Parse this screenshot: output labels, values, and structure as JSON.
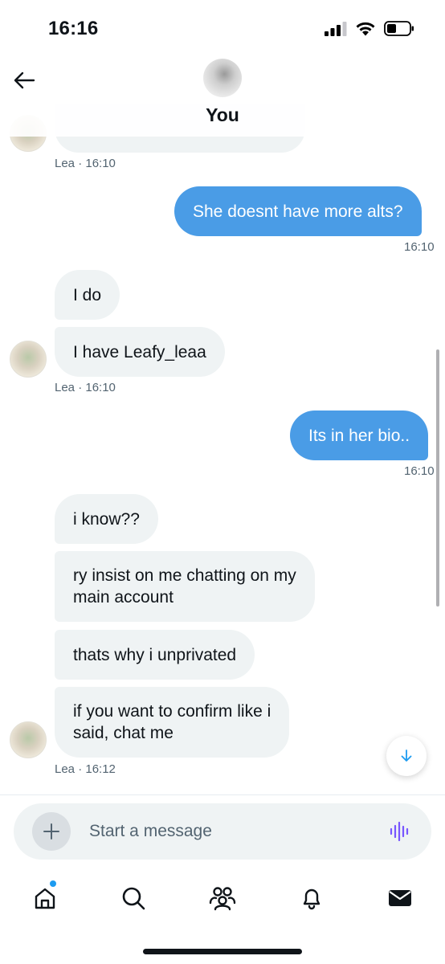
{
  "status_bar": {
    "time": "16:16"
  },
  "header": {
    "title": "You"
  },
  "messages": {
    "m1_meta": "Lea · 16:10",
    "m2_text": "She doesnt have more alts?",
    "m2_time": "16:10",
    "m3_text": "I do",
    "m4_text": "I have Leafy_leaa",
    "m4_meta": "Lea · 16:10",
    "m5_text": "Its in her bio..",
    "m5_time": "16:10",
    "m6_text": "i know??",
    "m7_line1": "ry insist on me chatting on my",
    "m7_line2": "main account",
    "m8_text": "thats why i unprivated",
    "m9_line1": "if you want to confirm like i",
    "m9_line2": "said, chat me",
    "m9_meta": "Lea · 16:12"
  },
  "composer": {
    "placeholder": "Start a message"
  },
  "icons": {
    "back": "arrow-left-icon",
    "add": "plus-icon",
    "voice": "voice-waveform-icon",
    "scroll_down": "arrow-down-icon",
    "tabs": [
      "home-icon",
      "search-icon",
      "communities-icon",
      "notifications-icon",
      "messages-icon"
    ]
  },
  "colors": {
    "outgoing_bubble": "#4a9ce6",
    "incoming_bubble": "#eff3f4",
    "accent": "#1d9bf0",
    "voice_icon": "#7856ff"
  }
}
